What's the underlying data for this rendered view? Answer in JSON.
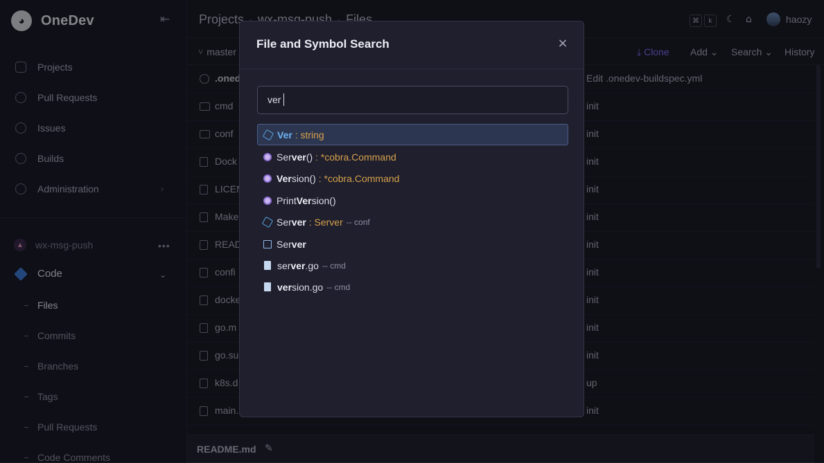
{
  "app": {
    "name": "OneDev"
  },
  "sidebar": {
    "items": [
      {
        "label": "Projects"
      },
      {
        "label": "Pull Requests"
      },
      {
        "label": "Issues"
      },
      {
        "label": "Builds"
      },
      {
        "label": "Administration"
      }
    ],
    "project": {
      "name": "wx-msg-push"
    },
    "section": {
      "label": "Code"
    },
    "subitems": [
      {
        "label": "Files"
      },
      {
        "label": "Commits"
      },
      {
        "label": "Branches"
      },
      {
        "label": "Tags"
      },
      {
        "label": "Pull Requests"
      },
      {
        "label": "Code Comments"
      }
    ]
  },
  "header": {
    "crumbs": [
      "Projects",
      "wx-msg-push",
      "Files"
    ],
    "kbd": [
      "⌘",
      "k"
    ],
    "user": "haozy"
  },
  "toolbar": {
    "branch": "master",
    "clone": "Clone",
    "add": "Add",
    "search": "Search",
    "history": "History"
  },
  "files": [
    {
      "name": ".onedev-buildspec.yml",
      "display": ".oned",
      "message": "Edit .onedev-buildspec.yml"
    },
    {
      "name": "cmd",
      "display": "cmd",
      "message": "init"
    },
    {
      "name": "conf",
      "display": "conf",
      "message": "init"
    },
    {
      "name": "Dockerfile",
      "display": "Dock",
      "message": "init"
    },
    {
      "name": "LICENSE",
      "display": "LICEN",
      "message": "init"
    },
    {
      "name": "Makefile",
      "display": "Make",
      "message": "init"
    },
    {
      "name": "README.md",
      "display": "READ",
      "message": "init"
    },
    {
      "name": "config",
      "display": "confi",
      "message": "init"
    },
    {
      "name": "docker",
      "display": "docke",
      "message": "init"
    },
    {
      "name": "go.mod",
      "display": "go.m",
      "message": "init"
    },
    {
      "name": "go.sum",
      "display": "go.su",
      "message": "init"
    },
    {
      "name": "k8s",
      "display": "k8s.d",
      "message": "up"
    },
    {
      "name": "main.go",
      "display": "main.",
      "message": "init"
    }
  ],
  "readme": {
    "title": "README.md"
  },
  "modal": {
    "title": "File and Symbol Search",
    "query": "ver",
    "results": [
      {
        "pre": "",
        "match": "Ver",
        "post": "",
        "type": ": string",
        "scope": ""
      },
      {
        "pre": "Ser",
        "match": "ver",
        "post": "()",
        "type": ": *cobra.Command",
        "scope": ""
      },
      {
        "pre": "",
        "match": "Ver",
        "post": "sion()",
        "type": ": *cobra.Command",
        "scope": ""
      },
      {
        "pre": "Print",
        "match": "Ver",
        "post": "sion()",
        "type": "",
        "scope": ""
      },
      {
        "pre": "Ser",
        "match": "ver",
        "post": "",
        "type": ": Server",
        "scope": "-- conf"
      },
      {
        "pre": "Ser",
        "match": "ver",
        "post": "",
        "type": "",
        "scope": ""
      },
      {
        "pre": "ser",
        "match": "ver",
        "post": ".go",
        "type": "",
        "scope": "-- cmd"
      },
      {
        "pre": "",
        "match": "ver",
        "post": "sion.go",
        "type": "",
        "scope": "-- cmd"
      }
    ]
  }
}
